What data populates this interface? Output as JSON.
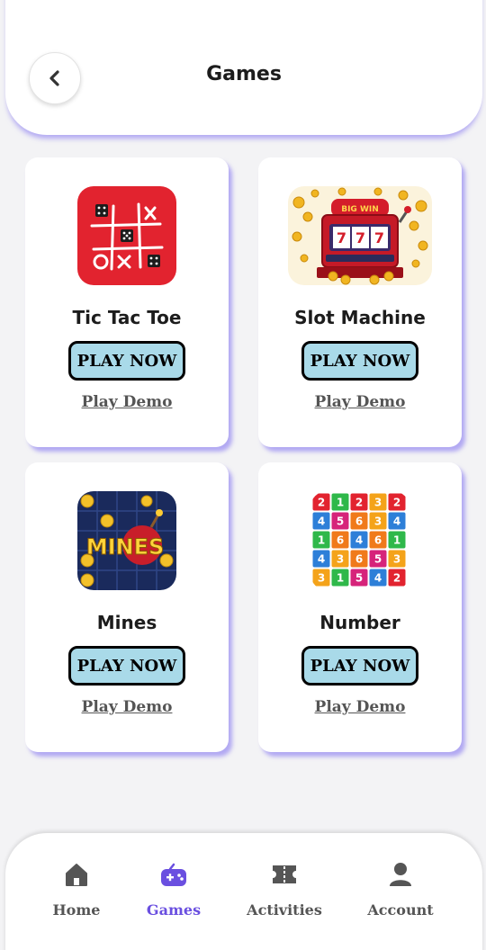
{
  "header": {
    "title": "Games",
    "back_icon": "chevron-left-icon"
  },
  "games": [
    {
      "name": "Tic Tac Toe",
      "play_label": "PLAY NOW",
      "demo_label": "Play Demo",
      "icon": "tic-tac-toe-icon"
    },
    {
      "name": "Slot Machine",
      "play_label": "PLAY NOW",
      "demo_label": "Play Demo",
      "icon": "slot-machine-icon"
    },
    {
      "name": "Mines",
      "play_label": "PLAY NOW",
      "demo_label": "Play Demo",
      "icon": "mines-icon",
      "logo_text": "MINES"
    },
    {
      "name": "Number",
      "play_label": "PLAY NOW",
      "demo_label": "Play Demo",
      "icon": "number-grid-icon"
    }
  ],
  "slot_logo_text": "BIG WIN",
  "number_grid": [
    [
      "2",
      "1",
      "2",
      "3",
      "2"
    ],
    [
      "4",
      "5",
      "6",
      "3",
      "4"
    ],
    [
      "1",
      "6",
      "4",
      "6",
      "1"
    ],
    [
      "4",
      "3",
      "6",
      "5",
      "3"
    ],
    [
      "3",
      "1",
      "5",
      "4",
      "2"
    ]
  ],
  "nav": {
    "items": [
      {
        "label": "Home",
        "icon": "home-icon"
      },
      {
        "label": "Games",
        "icon": "gamepad-icon",
        "active": true
      },
      {
        "label": "Activities",
        "icon": "ticket-icon"
      },
      {
        "label": "Account",
        "icon": "user-icon"
      }
    ]
  },
  "colors": {
    "accent": "#6a4fe0",
    "play_button": "#a9dae9",
    "shadow": "#7c6cf0"
  }
}
